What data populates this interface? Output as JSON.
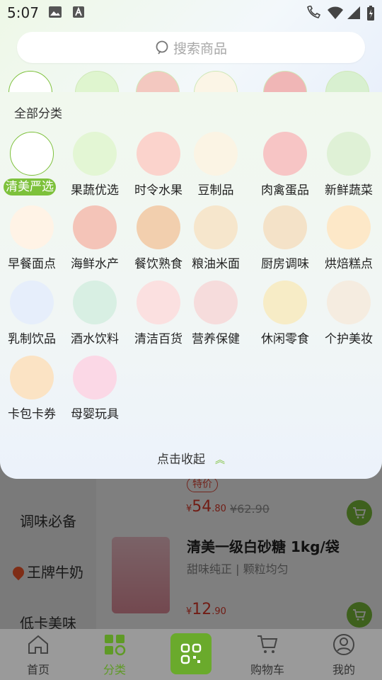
{
  "status_bar": {
    "time": "5:07"
  },
  "search": {
    "placeholder": "搜索商品",
    "icon": "search-icon"
  },
  "panel": {
    "title": "全部分类",
    "categories": [
      {
        "label": "清美严选",
        "active": true,
        "icon": "qingmei-logo-icon"
      },
      {
        "label": "果蔬优选",
        "icon": "fruit-basket-icon"
      },
      {
        "label": "时令水果",
        "icon": "watermelon-grapes-icon"
      },
      {
        "label": "豆制品",
        "icon": "soy-milk-icon"
      },
      {
        "label": "肉禽蛋品",
        "icon": "meat-icon"
      },
      {
        "label": "新鲜蔬菜",
        "icon": "vegetables-icon"
      },
      {
        "label": "早餐面点",
        "icon": "noodle-bowl-icon"
      },
      {
        "label": "海鲜水产",
        "icon": "crayfish-icon"
      },
      {
        "label": "餐饮熟食",
        "icon": "cooked-food-icon"
      },
      {
        "label": "粮油米面",
        "icon": "oil-rice-icon"
      },
      {
        "label": "厨房调味",
        "icon": "condiment-icon"
      },
      {
        "label": "烘焙糕点",
        "icon": "cake-icon"
      },
      {
        "label": "乳制饮品",
        "icon": "dairy-icon"
      },
      {
        "label": "酒水饮料",
        "icon": "beer-can-icon"
      },
      {
        "label": "清洁百货",
        "icon": "detergent-icon"
      },
      {
        "label": "营养保健",
        "icon": "supplement-icon"
      },
      {
        "label": "休闲零食",
        "icon": "snack-icon"
      },
      {
        "label": "个护美妆",
        "icon": "lotion-icon"
      },
      {
        "label": "卡包卡券",
        "icon": "gift-card-icon"
      },
      {
        "label": "母婴玩具",
        "icon": "mother-baby-icon"
      }
    ],
    "collapse_label": "点击收起"
  },
  "sidebar": {
    "items": [
      {
        "label": "调味必备"
      },
      {
        "label": "王牌牛奶",
        "hot": true
      },
      {
        "label": "低卡美味"
      }
    ]
  },
  "products": [
    {
      "tag": "特价",
      "price_int": "54",
      "price_dec": ".80",
      "old_price": "¥62.90"
    },
    {
      "title": "清美一级白砂糖 1kg/袋",
      "subtitle": "甜味纯正 | 颗粒均匀",
      "price_int": "12",
      "price_dec": ".90"
    }
  ],
  "currency_symbol": "¥",
  "nav": [
    {
      "label": "首页",
      "icon": "home-icon"
    },
    {
      "label": "分类",
      "icon": "category-icon",
      "active": true
    },
    {
      "label": "",
      "icon": "scan-icon"
    },
    {
      "label": "购物车",
      "icon": "cart-icon"
    },
    {
      "label": "我的",
      "icon": "profile-icon"
    }
  ],
  "colors": {
    "accent": "#7dc13b",
    "price": "#e23a2b"
  }
}
